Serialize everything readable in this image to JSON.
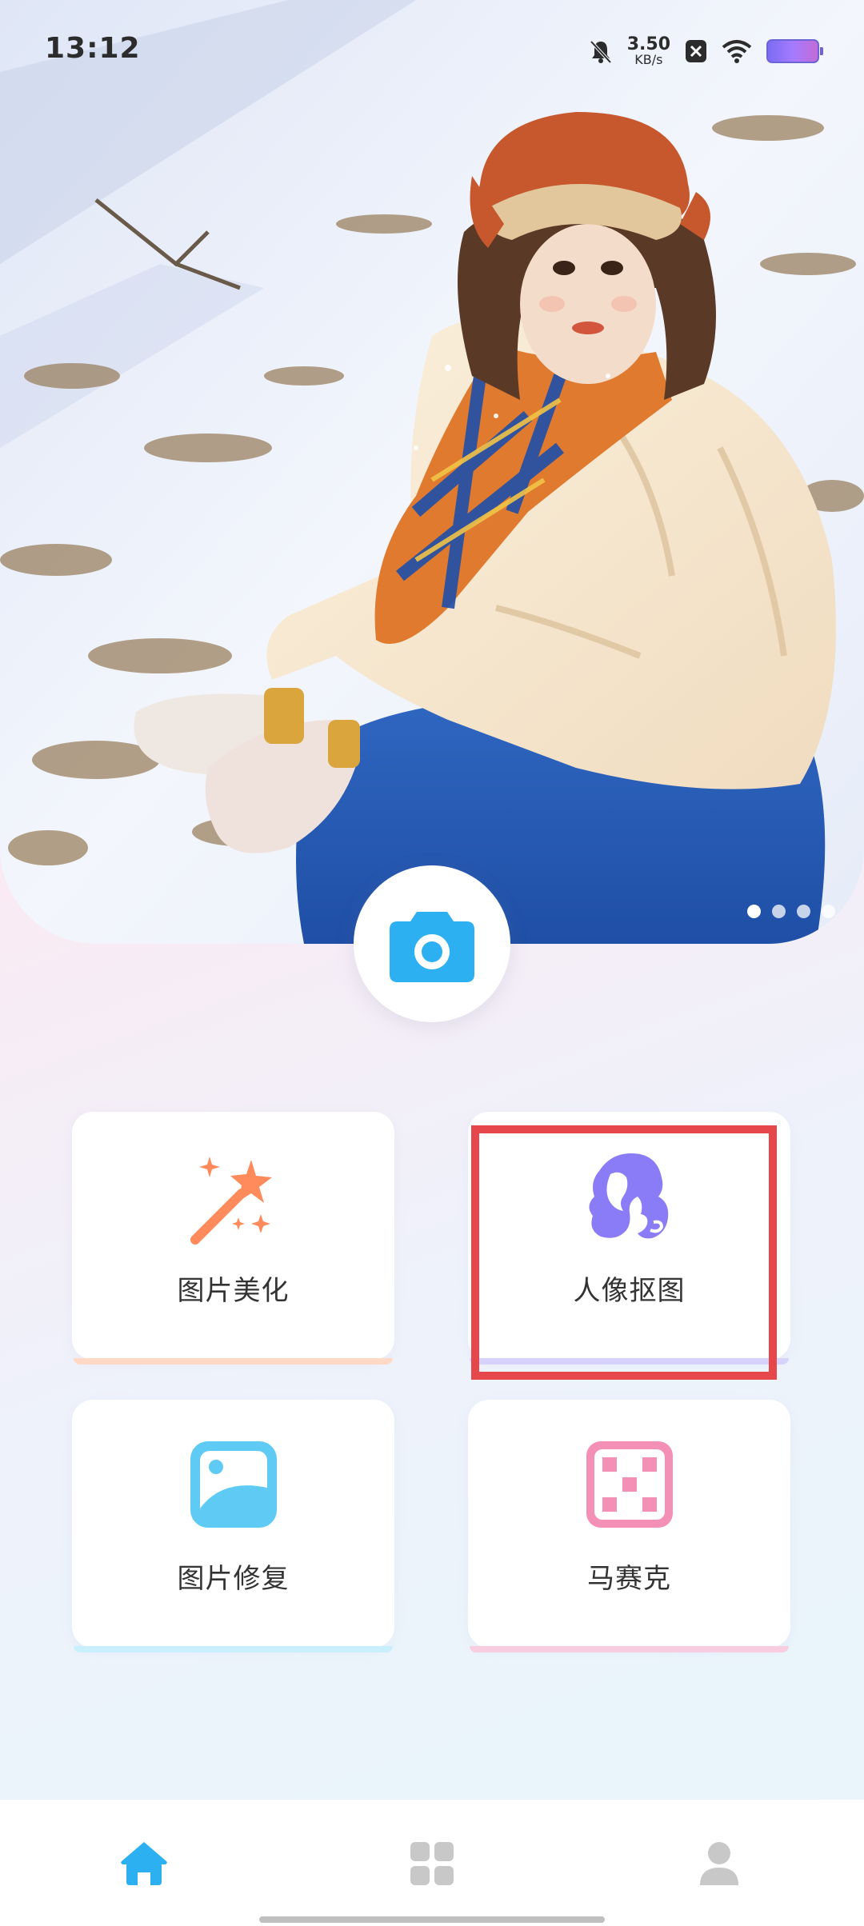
{
  "status_bar": {
    "time": "13:12",
    "net_speed_value": "3.50",
    "net_speed_unit": "KB/s",
    "icons": [
      "mute-bell-icon",
      "close-box-icon",
      "wifi-icon",
      "battery-icon"
    ]
  },
  "hero": {
    "image_subject": "girl in snow with orange hat and plaid scarf",
    "pager": {
      "count": 4,
      "active_index": 0
    }
  },
  "camera_button": {
    "icon": "camera-icon",
    "color": "#2cb0f2"
  },
  "features": [
    {
      "label": "图片美化",
      "icon": "magic-wand-icon",
      "color": "#ff8a5b",
      "underline": "#ffd9c6"
    },
    {
      "label": "人像抠图",
      "icon": "portrait-cutout-icon",
      "color": "#8a7cf7",
      "underline": "#d6d2fb"
    },
    {
      "label": "图片修复",
      "icon": "image-repair-icon",
      "color": "#5fcbf5",
      "underline": "#c9eefc"
    },
    {
      "label": "马赛克",
      "icon": "mosaic-icon",
      "color": "#f48fb5",
      "underline": "#f9cde0"
    }
  ],
  "bottom_nav": [
    {
      "name": "home",
      "icon": "home-icon",
      "active": true,
      "color": "#2cb0f2"
    },
    {
      "name": "apps",
      "icon": "grid-icon",
      "active": false,
      "color": "#c8c8c8"
    },
    {
      "name": "profile",
      "icon": "user-icon",
      "active": false,
      "color": "#c8c8c8"
    }
  ],
  "colors": {
    "accent": "#2cb0f2",
    "highlight": "#e5474b"
  }
}
